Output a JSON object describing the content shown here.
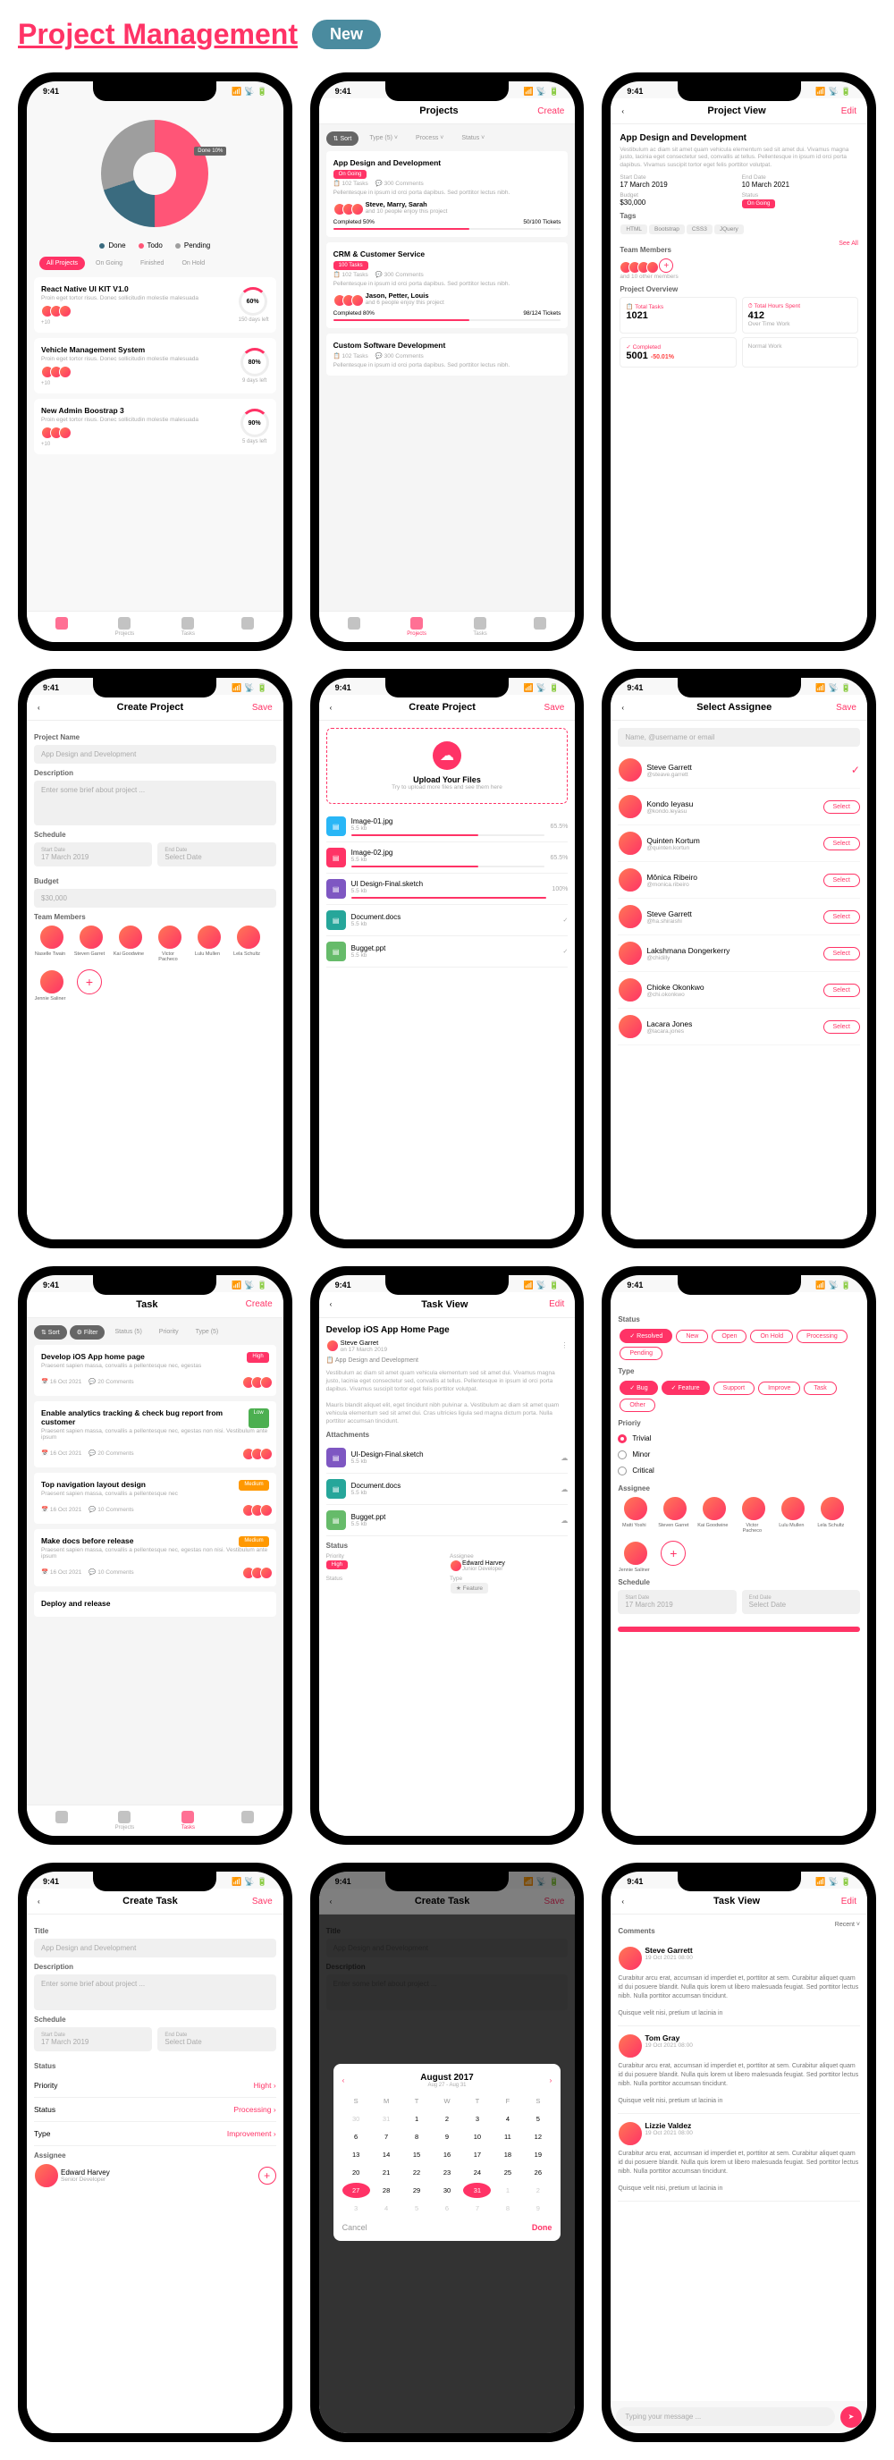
{
  "page": {
    "title": "Project Management",
    "badge": "New"
  },
  "status": {
    "time": "9:41"
  },
  "screens": {
    "dashboard": {
      "legend": [
        {
          "color": "#3A6B7F",
          "label": "Done"
        },
        {
          "color": "#FF5577",
          "label": "Todo"
        },
        {
          "color": "#9E9E9E",
          "label": "Pending"
        }
      ],
      "filters": [
        "All Projects",
        "On Going",
        "Finished",
        "On Hold"
      ],
      "projects": [
        {
          "title": "React Native UI KIT V1.0",
          "sub": "Proin eget tortor risus. Donec sollicitudin molestie malesuada",
          "pct": "60%",
          "days": "150 days left"
        },
        {
          "title": "Vehicle Management System",
          "sub": "Proin eget tortor risus. Donec sollicitudin molestie malesuada",
          "pct": "80%",
          "days": "9 days left"
        },
        {
          "title": "New Admin Boostrap 3",
          "sub": "Proin eget tortor risus. Donec sollicitudin molestie malesuada",
          "pct": "90%",
          "days": "5 days left"
        }
      ],
      "chart_data": {
        "type": "pie",
        "slices": [
          {
            "label": "Todo",
            "value": 50,
            "color": "#FF5577"
          },
          {
            "label": "Done",
            "value": 20,
            "color": "#3A6B7F"
          },
          {
            "label": "Pending",
            "value": 30,
            "color": "#9E9E9E"
          }
        ]
      }
    },
    "projects": {
      "title": "Projects",
      "action": "Create",
      "filters": [
        "Sort",
        "Type (5)",
        "Process",
        "Status"
      ],
      "items": [
        {
          "title": "App Design and Development",
          "status": "On Going",
          "tasks": "102 Tasks",
          "comments": "300 Comments",
          "team": "Steve, Marry, Sarah",
          "teamSub": "and 10 people enjoy this project",
          "progress": "Completed 50%",
          "tickets": "50/100 Tickets"
        },
        {
          "title": "CRM & Customer Service",
          "status": "100 Tasks",
          "tasks": "102 Tasks",
          "comments": "300 Comments",
          "team": "Jason, Petter, Louis",
          "teamSub": "and 6 people enjoy this project",
          "progress": "Completed 80%",
          "tickets": "98/124 Tickets"
        },
        {
          "title": "Custom Software Development",
          "tasks": "102 Tasks",
          "comments": "300 Comments"
        }
      ]
    },
    "projectView": {
      "title": "Project View",
      "action": "Edit",
      "name": "App Design and Development",
      "desc": "Vestibulum ac diam sit amet quam vehicula elementum sed sit amet dui. Vivamus magna justo, lacinia eget consectetur sed, convallis at tellus. Pellentesque in ipsum id orci porta dapibus. Vivamus suscipit tortor eget felis porttitor volutpat.",
      "start": "17 March 2019",
      "end": "10 March 2021",
      "budget": "$30,000",
      "status": "On Going",
      "tags": [
        "HTML",
        "Bootstrap",
        "CSS3",
        "JQuery"
      ],
      "teamLabel": "Team Members",
      "seeAll": "See All",
      "teamSub": "and 10 other members",
      "overview": "Project Overview",
      "stats": [
        {
          "label": "Total Tasks",
          "val": "1021"
        },
        {
          "label": "Total Hours Spent",
          "val": "412",
          "sub": "Over Time Work"
        },
        {
          "label": "Completed",
          "val": "5001",
          "delta": "-50.01%"
        },
        {
          "label": "Normal Work",
          "val": ""
        }
      ]
    },
    "createProject": {
      "title": "Create Project",
      "action": "Save",
      "fields": {
        "name": "Project Name",
        "namePlaceholder": "App Design and Development",
        "desc": "Description",
        "descPlaceholder": "Enter some brief about project ...",
        "schedule": "Schedule",
        "start": "Start Date",
        "startVal": "17 March 2019",
        "end": "End Date",
        "endVal": "Select Date",
        "budget": "Budget",
        "budgetVal": "$30,000",
        "team": "Team Members"
      },
      "members": [
        "Naselle Twain",
        "Steven Garret",
        "Kai Goodwine",
        "Victor Pacheco",
        "Lulu Mullen",
        "Lela Schultz",
        "Jennie Saliner"
      ]
    },
    "uploadFiles": {
      "title": "Create Project",
      "action": "Save",
      "uploadTitle": "Upload Your Files",
      "uploadSub": "Try to upload more files and see them here",
      "files": [
        {
          "name": "Image-01.jpg",
          "size": "5.5 kb",
          "pct": "65.5%",
          "color": "#29B6F6"
        },
        {
          "name": "Image-02.jpg",
          "size": "5.5 kb",
          "pct": "65.5%",
          "color": "#FF3366"
        },
        {
          "name": "UI Design-Final.sketch",
          "size": "5.5 kb",
          "pct": "100%",
          "color": "#7E57C2"
        },
        {
          "name": "Document.docs",
          "size": "5.5 kb",
          "pct": "",
          "color": "#26A69A"
        },
        {
          "name": "Bugget.ppt",
          "size": "5.5 kb",
          "pct": "",
          "color": "#66BB6A"
        }
      ]
    },
    "assignee": {
      "title": "Select Assignee",
      "action": "Save",
      "search": "Name, @username or email",
      "people": [
        {
          "name": "Steve Garrett",
          "handle": "@steave.garrett",
          "selected": true
        },
        {
          "name": "Kondo Ieyasu",
          "handle": "@kondo.leyasu"
        },
        {
          "name": "Quinten Kortum",
          "handle": "@quinten.kortun"
        },
        {
          "name": "Mônica Ribeiro",
          "handle": "@monica.ribeiro"
        },
        {
          "name": "Steve Garrett",
          "handle": "@ha.shiraishi"
        },
        {
          "name": "Lakshmana Dongerkerry",
          "handle": "@chidilly"
        },
        {
          "name": "Chioke Okonkwo",
          "handle": "@chi.okonkwo"
        },
        {
          "name": "Lacara Jones",
          "handle": "@lacara.jones"
        }
      ],
      "selectLabel": "Select"
    },
    "tasks": {
      "title": "Task",
      "action": "Create",
      "filters": [
        "Sort",
        "Filter",
        "Status (5)",
        "Priority",
        "Type (5)"
      ],
      "items": [
        {
          "title": "Develop iOS App home page",
          "desc": "Praesent sapien massa, convallis a pellentesque nec, egestas",
          "date": "16 Oct 2021",
          "comments": "20 Comments",
          "badge": "High",
          "badgeColor": "pink"
        },
        {
          "title": "Enable analytics tracking & check bug report from customer",
          "desc": "Praesent sapien massa, convallis a pellentesque nec, egestas non nisi. Vestibulum ante ipsum",
          "date": "16 Oct 2021",
          "comments": "20 Comments",
          "badge": "Low",
          "badgeColor": "green"
        },
        {
          "title": "Top navigation layout design",
          "desc": "Praesent sapien massa, convallis a pellentesque nec",
          "date": "16 Oct 2021",
          "comments": "10 Comments",
          "badge": "Medium",
          "badgeColor": "orange"
        },
        {
          "title": "Make docs before release",
          "desc": "Praesent sapien massa, convallis a pellentesque nec, egestas non nisi. Vestibulum ante ipsum",
          "date": "16 Oct 2021",
          "comments": "10 Comments",
          "badge": "Medium",
          "badgeColor": "orange"
        },
        {
          "title": "Deploy and release"
        }
      ]
    },
    "taskView": {
      "title": "Task View",
      "action": "Edit",
      "name": "Develop iOS App Home Page",
      "author": "Steve Garret",
      "authorSub": "on 17 March 2019",
      "project": "App Design and Development",
      "desc": "Vestibulum ac diam sit amet quam vehicula elementum sed sit amet dui. Vivamus magna justo, lacinia eget consectetur sed, convallis at tellus. Pellentesque in ipsum id orci porta dapibus. Vivamus suscipit tortor eget felis porttitor volutpat.\n\nMauris blandit aliquet elit, eget tincidunt nibh pulvinar a. Vestibulum ac diam sit amet quam vehicula elementum sed sit amet dui. Cras ultricies ligula sed magna dictum porta. Nulla porttitor accumsan tincidunt.",
      "attachLabel": "Attachments",
      "files": [
        {
          "name": "UI-Design-Final.sketch",
          "size": "5.5 kb",
          "color": "#7E57C2"
        },
        {
          "name": "Document.docs",
          "size": "5.5 kb",
          "color": "#26A69A"
        },
        {
          "name": "Bugget.ppt",
          "size": "5.5 kb",
          "color": "#66BB6A"
        }
      ],
      "statusLabel": "Status",
      "priority": "Priority",
      "assigneeLabel": "Assignee",
      "assigneeName": "Edward Harvey",
      "assigneeRole": "Junior Developer",
      "type": "Type",
      "typeVal": "Feature"
    },
    "filters": {
      "statusLabel": "Status",
      "status": [
        "Resolved",
        "New",
        "Open",
        "On Hold",
        "Processing",
        "Pending"
      ],
      "typeLabel": "Type",
      "types": [
        "Bug",
        "Feature",
        "Support",
        "Improve",
        "Task",
        "Other"
      ],
      "priorityLabel": "Prioriy",
      "priorities": [
        "Trivial",
        "Minor",
        "Critical"
      ],
      "assigneeLabel": "Assignee",
      "scheduleLabel": "Schedule",
      "start": "17 March 2019",
      "end": "Select Date",
      "members": [
        "Matti Yoshi",
        "Steven Garret",
        "Kai Goodwine",
        "Victor Pacheco",
        "Lulu Mullen",
        "Lela Schultz",
        "Jennie Saliner"
      ]
    },
    "createTask": {
      "title": "Create Task",
      "action": "Save",
      "fields": {
        "title": "Title",
        "titlePlaceholder": "App Design and Development",
        "desc": "Description",
        "descPlaceholder": "Enter some brief about project ...",
        "schedule": "Schedule",
        "start": "Start Date",
        "startVal": "17 March 2019",
        "end": "End Date",
        "endVal": "Select Date",
        "status": "Status",
        "assignee": "Assignee",
        "assigneeName": "Edward Harvey",
        "assigneeRole": "Senior Developer"
      },
      "settings": [
        {
          "label": "Priority",
          "val": "Hight"
        },
        {
          "label": "Status",
          "val": "Processing"
        },
        {
          "label": "Type",
          "val": "Improvement"
        }
      ]
    },
    "calendar": {
      "month": "August 2017",
      "range": "Aug 27 - Aug 31",
      "dow": [
        "S",
        "M",
        "T",
        "W",
        "T",
        "F",
        "S"
      ],
      "days": [
        {
          "n": "30",
          "dim": true
        },
        {
          "n": "31",
          "dim": true
        },
        {
          "n": "1"
        },
        {
          "n": "2"
        },
        {
          "n": "3"
        },
        {
          "n": "4"
        },
        {
          "n": "5"
        },
        {
          "n": "6"
        },
        {
          "n": "7"
        },
        {
          "n": "8"
        },
        {
          "n": "9"
        },
        {
          "n": "10"
        },
        {
          "n": "11"
        },
        {
          "n": "12"
        },
        {
          "n": "13"
        },
        {
          "n": "14"
        },
        {
          "n": "15"
        },
        {
          "n": "16"
        },
        {
          "n": "17"
        },
        {
          "n": "18"
        },
        {
          "n": "19"
        },
        {
          "n": "20"
        },
        {
          "n": "21"
        },
        {
          "n": "22"
        },
        {
          "n": "23"
        },
        {
          "n": "24"
        },
        {
          "n": "25"
        },
        {
          "n": "26"
        },
        {
          "n": "27",
          "sel": true
        },
        {
          "n": "28"
        },
        {
          "n": "29"
        },
        {
          "n": "30"
        },
        {
          "n": "31",
          "sel": true
        },
        {
          "n": "1",
          "dim": true
        },
        {
          "n": "2",
          "dim": true
        },
        {
          "n": "3",
          "dim": true
        },
        {
          "n": "4",
          "dim": true
        },
        {
          "n": "5",
          "dim": true
        },
        {
          "n": "6",
          "dim": true
        },
        {
          "n": "7",
          "dim": true
        },
        {
          "n": "8",
          "dim": true
        },
        {
          "n": "9",
          "dim": true
        }
      ],
      "cancel": "Cancel",
      "done": "Done"
    },
    "comments": {
      "title": "Task View",
      "action": "Edit",
      "label": "Comments",
      "sort": "Recent",
      "items": [
        {
          "name": "Steve Garrett",
          "date": "19 Oct 2021 08:00",
          "text": "Curabitur arcu erat, accumsan id imperdiet et, porttitor at sem. Curabitur aliquet quam id dui posuere blandit. Nulla quis lorem ut libero malesuada feugiat. Sed porttitor lectus nibh. Nulla porttitor accumsan tincidunt.\n\nQuisque velit nisi, pretium ut lacinia in"
        },
        {
          "name": "Tom Gray",
          "date": "19 Oct 2021 08:00",
          "text": "Curabitur arcu erat, accumsan id imperdiet et, porttitor at sem. Curabitur aliquet quam id dui posuere blandit. Nulla quis lorem ut libero malesuada feugiat. Sed porttitor lectus nibh. Nulla porttitor accumsan tincidunt.\n\nQuisque velit nisi, pretium ut lacinia in"
        },
        {
          "name": "Lizzie Valdez",
          "date": "19 Oct 2021 08:00",
          "text": "Curabitur arcu erat, accumsan id imperdiet et, porttitor at sem. Curabitur aliquet quam id dui posuere blandit. Nulla quis lorem ut libero malesuada feugiat. Sed porttitor lectus nibh. Nulla porttitor accumsan tincidunt.\n\nQuisque velit nisi, pretium ut lacinia in"
        }
      ],
      "placeholder": "Typing your message ..."
    },
    "nav": [
      "",
      "Projects",
      "Tasks",
      ""
    ]
  }
}
